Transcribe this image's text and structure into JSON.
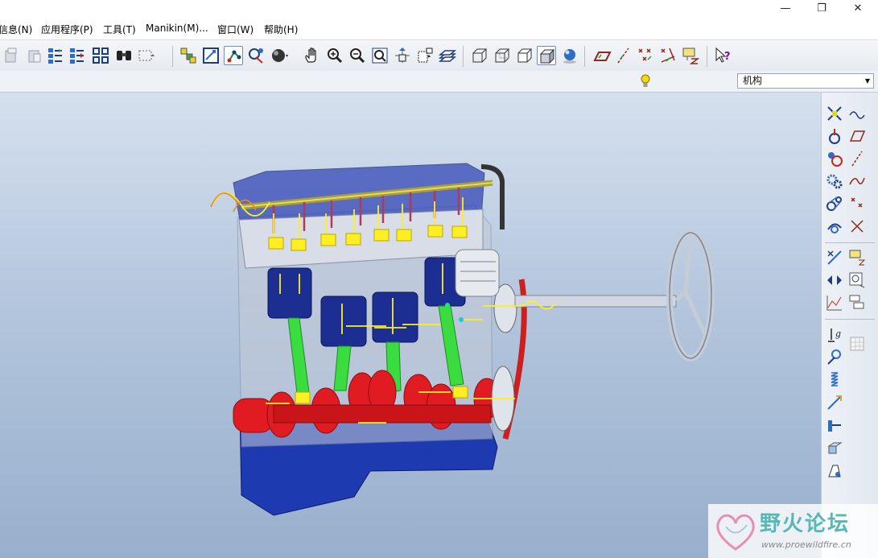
{
  "window": {
    "controls": {
      "minimize": "—",
      "maximize": "❐",
      "close": "✕"
    }
  },
  "menu": {
    "items": [
      "信息(N)",
      "应用程序(P)",
      "工具(T)",
      "Manikin(M)...",
      "窗口(W)",
      "帮助(H)"
    ]
  },
  "toolbar": {
    "icons": [
      "copy-icon",
      "paste-icon",
      "regenerate-icon",
      "regenerate-manager-icon",
      "model-tree-icon",
      "find-icon",
      "select-box-icon",
      "layer-icon",
      "repaint-icon",
      "datum-display-icon",
      "orient-icon",
      "shading-icon",
      "pan-icon",
      "zoom-in-icon",
      "zoom-out-icon",
      "refit-icon",
      "spin-center-icon",
      "saved-views-icon",
      "view-manager-icon",
      "wireframe-icon",
      "hidden-line-icon",
      "no-hidden-icon",
      "shaded-icon",
      "enhanced-realism-icon",
      "plane-display-icon",
      "axis-display-icon",
      "point-display-icon",
      "csys-display-icon",
      "annotation-display-icon",
      "whats-this-icon"
    ],
    "active": [
      "datum-display-icon",
      "shaded-icon"
    ]
  },
  "subbar": {
    "mode_select": {
      "value": "机构"
    },
    "indicator_icon": "light-bulb-icon"
  },
  "right_tools": {
    "icons": [
      "connect-icon",
      "servo-motor-icon",
      "cam-icon",
      "slot-icon",
      "gear-icon",
      "belt-icon",
      "3d-contact-icon",
      "spring-dir-icon",
      "joint-axis-icon",
      "damper-icon",
      "force-icon",
      "measure-icon",
      "drag-icon",
      "run-analysis-icon",
      "playback-icon",
      "results-icon",
      "graph-icon",
      "gravity-icon",
      "initial-condition-icon",
      "spring-icon",
      "damper2-icon",
      "force-torque-icon",
      "mass-properties-icon",
      "separate-icon"
    ]
  },
  "watermark": {
    "title": "野火论坛",
    "url": "www.proewildfire.cn"
  },
  "colors": {
    "viewport_top": "#d5e0ee",
    "viewport_bottom": "#98afcd",
    "engine_blue": "#1a2fa8",
    "crank_red": "#e01b22",
    "rod_green": "#2fd23a",
    "motion_yellow": "#ffee22"
  }
}
